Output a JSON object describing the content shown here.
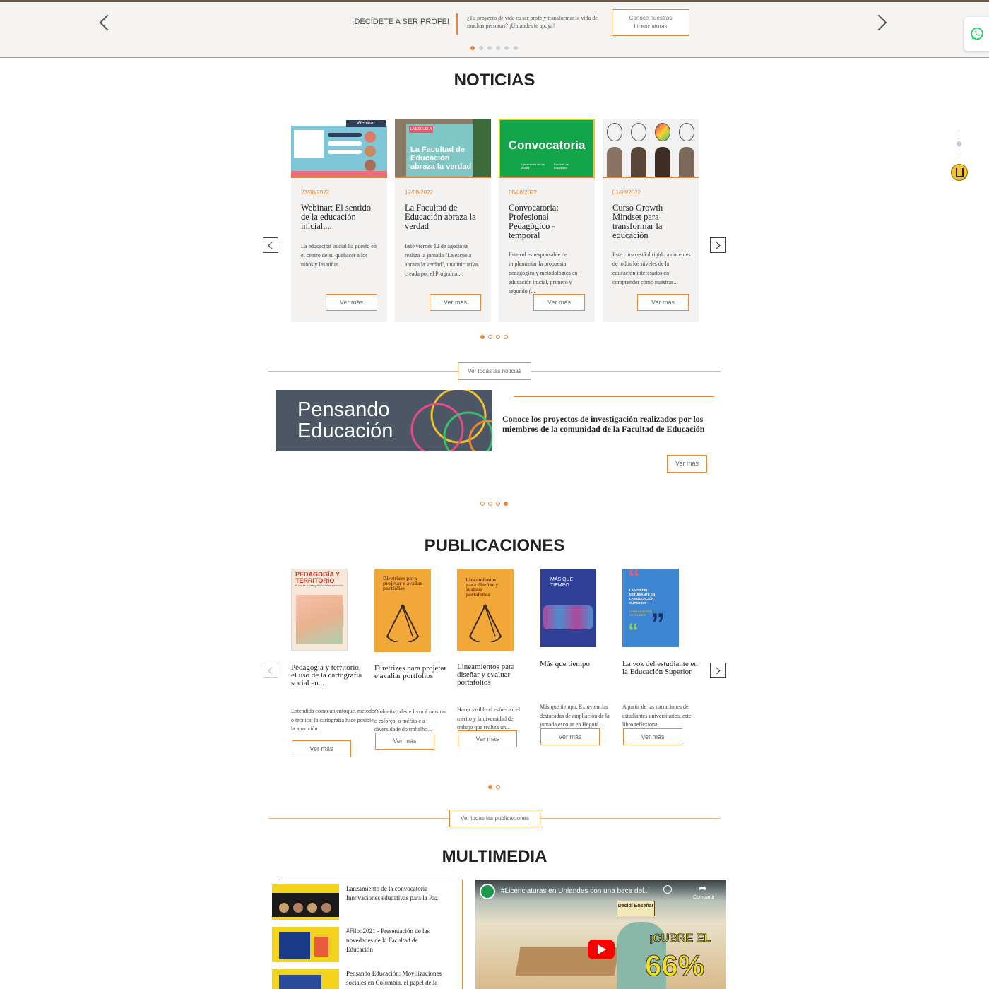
{
  "banner": {
    "title": "¡DECÍDETE A SER PROFE!",
    "text": "¿Tu proyecto de vida es ser profe y transformar la vida de muchas personas? ¡Uniandes te apoya!",
    "button": "Conoce nuestras Licenciaturas"
  },
  "noticias": {
    "title": "NOTICIAS",
    "cards": [
      {
        "date": "23/08/2022",
        "title": "Webinar: El sentido de la educación inicial,...",
        "body": "La educación inicial ha puesto en el centro de su quehacer a los niños y las niñas.",
        "button": "Ver más",
        "img_label": "Webinar"
      },
      {
        "date": "12/08/2022",
        "title": "La Facultad de Educación abraza la verdad",
        "body": "Este viernes 12 de agosto se realiza la jornada \"La escuela abraza la verdad\", una iniciativa creada por el Programa...",
        "button": "Ver más",
        "img_label": "La Facultad de Educación abraza la verdad",
        "img_tag": "LA ESCUELA"
      },
      {
        "date": "08/08/2022",
        "title": "Convocatoria: Profesional Pedagógico - temporal",
        "body": "Este rol es responsable de implementar la propuesta pedagógica y metodológica en educación inicial, primero y segundo (...",
        "button": "Ver más",
        "img_label": "Convocatoria",
        "img_sub1": "Universidad de los Andes",
        "img_sub2": "Facultad de Educación"
      },
      {
        "date": "01/08/2022",
        "title": "Curso Growth Mindset para transformar la educación",
        "body": "Este curso está dirigido a docentes de todos los niveles de la educación interesados en comprender cómo nuestras...",
        "button": "Ver más"
      }
    ],
    "all_button": "Ver todas las noticias"
  },
  "pensando": {
    "img_text_1": "Pensando",
    "img_text_2": "Educación",
    "text": "Conoce los proyectos de investigación realizados por los miembros de la comunidad de la Facultad de Educación",
    "button": "Ver más"
  },
  "publicaciones": {
    "title": "PUBLICACIONES",
    "items": [
      {
        "cover_title": "PEDAGOGÍA Y TERRITORIO",
        "cover_sub": "El uso de la cartografía social en educación",
        "title": "Pedagogía y territorio, el uso de la cartografía social en...",
        "body": "Entendida como un enfoque, método o técnica, la cartografía hace posible la aparición...",
        "button": "Ver más"
      },
      {
        "cover_title": "Diretrizes para projetar e avaliar portfólios",
        "title": "Diretrizes para projetar e avaliar portfolios",
        "body": "O objetivo deste livro é mostrar o esforço, o mérito e a diversidade do trabalho...",
        "button": "Ver más"
      },
      {
        "cover_title": "Lineamientos para diseñar y evaluar portafolios",
        "title": "Lineamientos para diseñar y evaluar portafolios",
        "body": "Hacer visible el esfuerzo, el mérito y la diversidad del trabajo que realiza un...",
        "button": "Ver más"
      },
      {
        "cover_title": "MÁS QUE TIEMPO",
        "title": "Más que tiempo",
        "body": "Más que tiempo. Experiencias destacadas de ampliación de la jornada escolar en Bogotá...",
        "button": "Ver más"
      },
      {
        "cover_title": "LA VOZ DEL ESTUDIANTE EN LA EDUCACIÓN SUPERIOR",
        "cover_sub": "UN MUNDO POR DESCUBRIR",
        "title": "La voz del estudiante en la Educación Superior",
        "body": "A partir de las narraciones de estudiantes universitarios, este libro reflexiona...",
        "button": "Ver más"
      }
    ],
    "all_button": "Ver todas las publicaciones"
  },
  "multimedia": {
    "title": "MULTIMEDIA",
    "items": [
      {
        "title": "Lanzamiento de la convocatoria Innovaciones educativas para la Paz"
      },
      {
        "title": "#Filbo2021 - Presentación de las novedades de la Facultad de Educación"
      },
      {
        "title": "Pensando Educación: Movilizaciones sociales en Colombia, el papel de la"
      }
    ],
    "video": {
      "title": "#Licenciaturas en Uniandes con una beca del...",
      "sign": "Decidí Enseñar",
      "promo": "¡CUBRE EL",
      "percent": "66%",
      "share": "Compartir"
    }
  }
}
